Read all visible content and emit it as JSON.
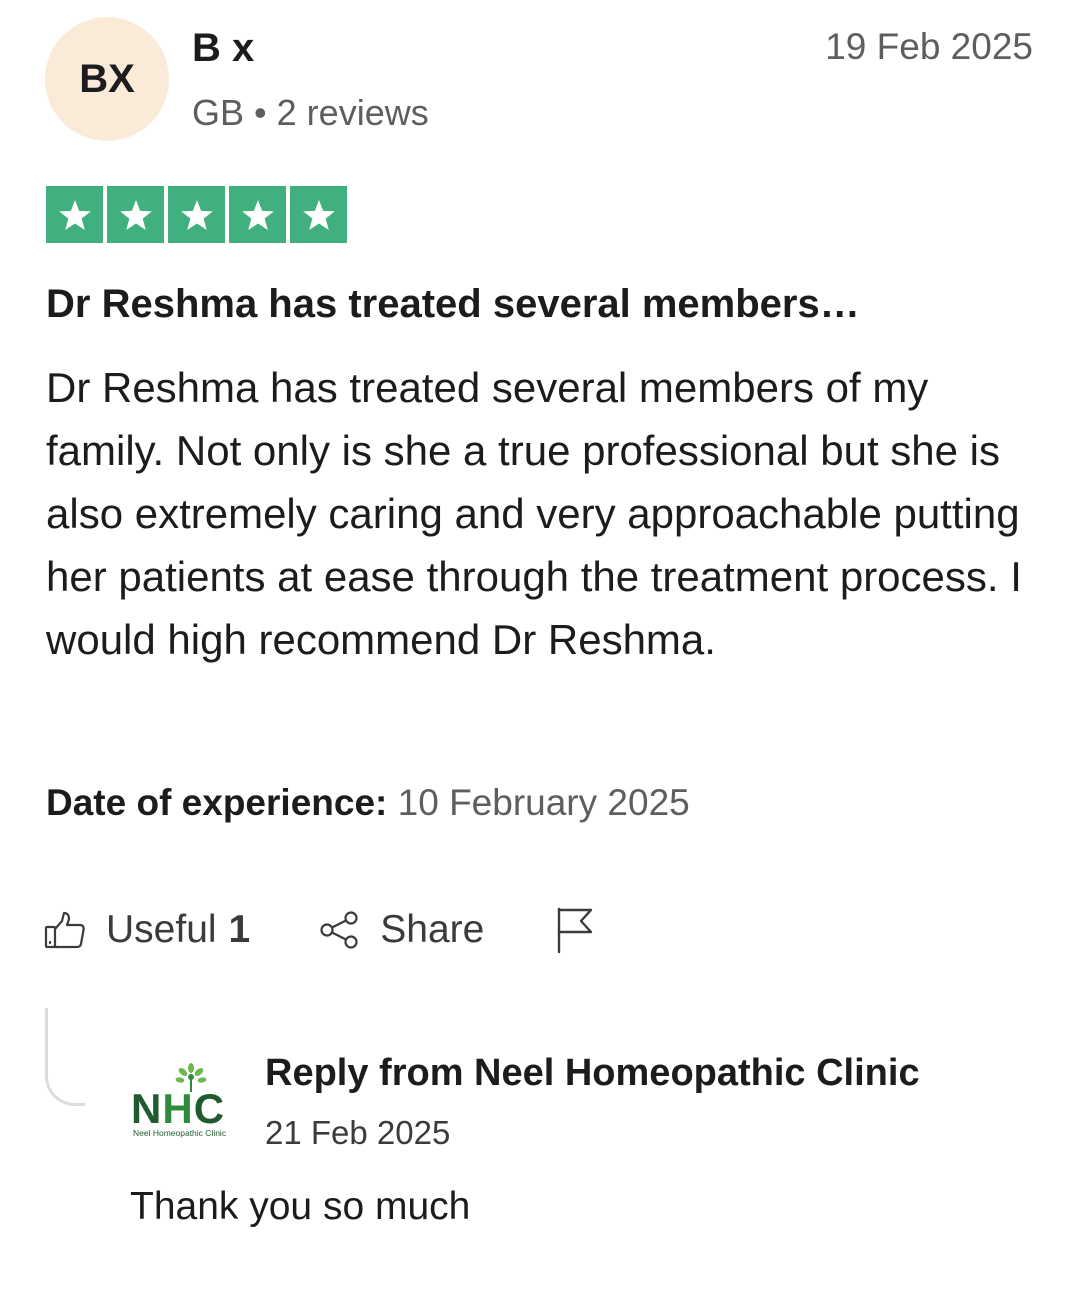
{
  "reviewer": {
    "initials": "BX",
    "name": "B x",
    "country": "GB",
    "separator": "•",
    "reviews_count": "2 reviews"
  },
  "review": {
    "date": "19 Feb 2025",
    "rating": 5,
    "rating_max": 5,
    "star_color": "#3fb07e",
    "title": "Dr Reshma has treated several members…",
    "body": "Dr Reshma has treated several members of my family. Not only is she a true professional but she is also extremely caring and very approachable putting her patients at ease through the treatment process. I would high recommend Dr Reshma.",
    "experience_label": "Date of experience:",
    "experience_date": "10 February 2025"
  },
  "actions": {
    "useful_label": "Useful",
    "useful_count": "1",
    "share_label": "Share",
    "useful_icon": "thumbs-up-icon",
    "share_icon": "share-icon",
    "report_icon": "flag-icon"
  },
  "reply": {
    "logo_text_n": "N",
    "logo_text_h": "H",
    "logo_text_c": "C",
    "logo_subtitle": "Neel Homeopathic Clinic",
    "from": "Reply from Neel Homeopathic Clinic",
    "date": "21 Feb 2025",
    "text": "Thank you so much"
  }
}
